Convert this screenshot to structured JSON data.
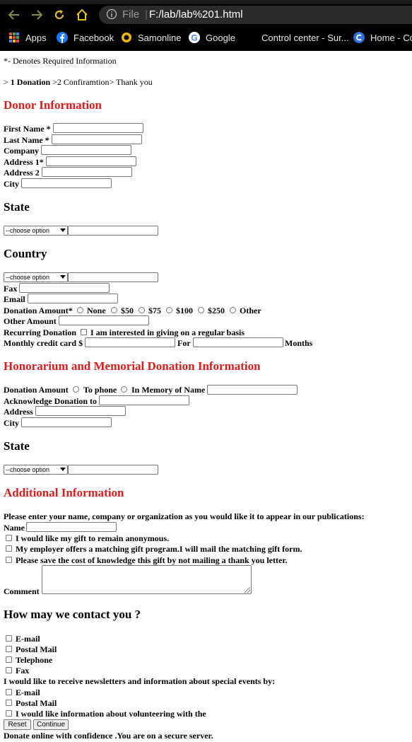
{
  "browser": {
    "address": {
      "file_label": "File",
      "separator": "|",
      "url": "F:/lab/lab%201.html"
    },
    "bookmarks": [
      {
        "label": "Apps",
        "icon": "apps-grid-icon"
      },
      {
        "label": "Facebook",
        "icon": "facebook-icon"
      },
      {
        "label": "Samonline",
        "icon": "samonline-icon"
      },
      {
        "label": "Google",
        "icon": "google-icon"
      },
      {
        "label": "Control center - Sur...",
        "icon": ""
      },
      {
        "label": "Home - Co",
        "icon": "home-co-icon"
      }
    ]
  },
  "page": {
    "required_note": "*- Denotes Required Information",
    "steps": {
      "prefix": "> ",
      "step1": "1 Donation",
      "rest": " >2 Confiramtion> Thank you"
    },
    "donor": {
      "heading": "Donor Information",
      "first_name": "First Name *",
      "last_name": "Last Name *",
      "company": "Company",
      "address1": "Address 1*",
      "address2": "Address 2",
      "city": "City",
      "state_heading": "State",
      "state_select": "--choose option",
      "country_heading": "Country",
      "country_select": "--choose option",
      "fax": "Fax",
      "email": "Email",
      "amount_label": "Donation Amount*",
      "amount_options": [
        "None",
        "$50",
        "$75",
        "$100",
        "$250",
        "Other"
      ],
      "other_amount": "Other Amount",
      "recurring_label": "Recurring Donation",
      "recurring_option": "I am interested in giving on a regular basis",
      "monthly_label": "Monthly credit card $",
      "for_label": "For",
      "months_label": "Months"
    },
    "honor": {
      "heading": "Honorarium and Memorial Donation Information",
      "amount_label": "Donation Amount",
      "options": [
        "To phone",
        "In Memory of Name"
      ],
      "acknowledge": "Acknowledge Donation to",
      "address": "Address",
      "city": "City",
      "state_heading": "State",
      "state_select": "--choose option"
    },
    "additional": {
      "heading": "Additional Information",
      "publication_prompt": "Please enter your name, company or organization as you would like it to appear in our publications:",
      "name": "Name",
      "checks": [
        "I would like my gift to remain anonymous.",
        "My employer offers a matching gift program.I will mail the matching gift form.",
        "Please save the cost of knowledge this gift by not mailing a thank you letter."
      ],
      "comment": "Comment"
    },
    "contact": {
      "heading": "How may we contact you ?",
      "methods": [
        "E-mail",
        "Postal Mail",
        "Telephone",
        "Fax"
      ],
      "newsletter_prompt": "I would like to receive newsletters and information about special events by:",
      "newsletter_methods": [
        "E-mail",
        "Postal Mail",
        "I would like information about volunteering with the"
      ]
    },
    "buttons": {
      "reset": "Reset",
      "continue": "Continue"
    },
    "footer": "Donate online with confidence .You are on a secure server."
  }
}
